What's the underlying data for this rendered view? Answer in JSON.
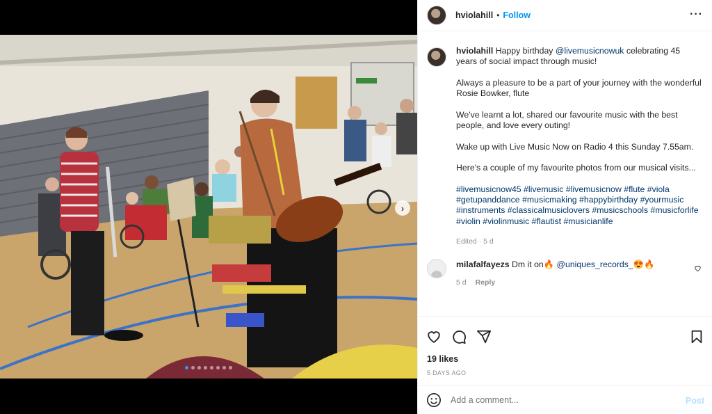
{
  "post": {
    "username": "hviolahill",
    "separator": "•",
    "follow_label": "Follow",
    "more_label": "···"
  },
  "caption": {
    "username": "hviolahill",
    "line1_pre": "Happy birthday ",
    "mention": "@livemusicnowuk",
    "line1_post": " celebrating 45 years of social impact through music!",
    "para2": "Always a pleasure to be a part of your journey with the wonderful Rosie Bowker, flute",
    "para3": "We've learnt a lot, shared our favourite music with the best people, and love every outing!",
    "para4": "Wake up with Live Music Now on Radio 4 this Sunday 7.55am.",
    "para5": "Here's a couple of my favourite photos from our musical visits...",
    "hashtags": "#livemusicnow45 #livemusic #livemusicnow #flute #viola #getupanddance #musicmaking #happybirthday #yourmusic #instruments #classicalmusiclovers #musicschools #musicforlife #violin #violinmusic #flautist #musicianlife",
    "meta": "Edited · 5 d"
  },
  "comment": {
    "username": "milafalfayezs",
    "text_pre": "Dm it on🔥 ",
    "mention": "@uniques_records_",
    "text_post": "😍🔥",
    "time": "5 d",
    "reply_label": "Reply"
  },
  "stats": {
    "likes": "19 likes",
    "date": "5 DAYS AGO"
  },
  "add_comment": {
    "placeholder": "Add a comment...",
    "post_label": "Post"
  },
  "carousel": {
    "next_label": "›",
    "slide_count": 8,
    "active_index": 0
  },
  "colors": {
    "accent": "#0095f6",
    "link": "#00376b",
    "muted": "#8e8e8e",
    "post_disabled": "#b2dffc"
  },
  "icons": [
    "heart-icon",
    "comment-icon",
    "share-icon",
    "bookmark-icon",
    "emoji-icon",
    "more-icon",
    "chevron-right-icon"
  ]
}
